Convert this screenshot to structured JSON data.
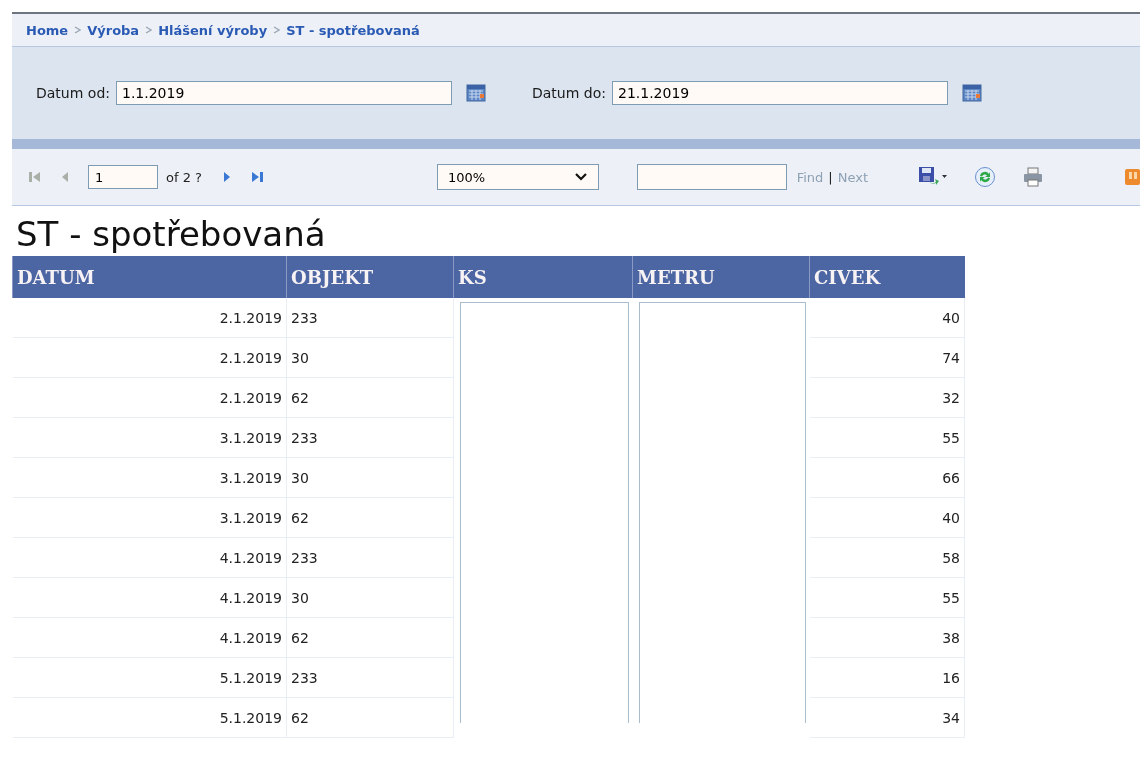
{
  "breadcrumb": [
    "Home",
    "Výroba",
    "Hlášení výroby",
    "ST - spotřebovaná"
  ],
  "filters": [
    {
      "label": "Datum od:",
      "value": "1.1.2019"
    },
    {
      "label": "Datum do:",
      "value": "21.1.2019"
    }
  ],
  "toolbar": {
    "first_disabled": true,
    "prev_disabled": true,
    "next_disabled": false,
    "last_disabled": false,
    "page": "1",
    "page_count": "of 2 ?",
    "zoom": "100%",
    "find": "Find",
    "separator": "|",
    "next": "Next"
  },
  "report": {
    "title": "ST - spotřebovaná",
    "columns": [
      "DATUM",
      "OBJEKT",
      "KS",
      "METRU",
      "CIVEK"
    ],
    "rows": [
      {
        "datum": "2.1.2019",
        "objekt": "233",
        "civek": "40"
      },
      {
        "datum": "2.1.2019",
        "objekt": "30",
        "civek": "74"
      },
      {
        "datum": "2.1.2019",
        "objekt": "62",
        "civek": "32"
      },
      {
        "datum": "3.1.2019",
        "objekt": "233",
        "civek": "55"
      },
      {
        "datum": "3.1.2019",
        "objekt": "30",
        "civek": "66"
      },
      {
        "datum": "3.1.2019",
        "objekt": "62",
        "civek": "40"
      },
      {
        "datum": "4.1.2019",
        "objekt": "233",
        "civek": "58"
      },
      {
        "datum": "4.1.2019",
        "objekt": "30",
        "civek": "55"
      },
      {
        "datum": "4.1.2019",
        "objekt": "62",
        "civek": "38"
      },
      {
        "datum": "5.1.2019",
        "objekt": "233",
        "civek": "16"
      },
      {
        "datum": "5.1.2019",
        "objekt": "62",
        "civek": "34"
      }
    ]
  }
}
